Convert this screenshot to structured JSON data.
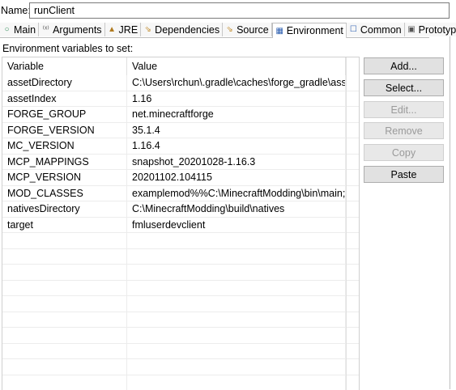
{
  "name_row": {
    "label": "Name:",
    "value": "runClient"
  },
  "tabs": [
    {
      "label": "Main",
      "icon": "○"
    },
    {
      "label": "Arguments",
      "icon": "⁽ˣ⁾"
    },
    {
      "label": "JRE",
      "icon": "▲"
    },
    {
      "label": "Dependencies",
      "icon": "⇘"
    },
    {
      "label": "Source",
      "icon": "⇘"
    },
    {
      "label": "Environment",
      "icon": "▦"
    },
    {
      "label": "Common",
      "icon": "☐"
    },
    {
      "label": "Prototype",
      "icon": "▣"
    }
  ],
  "section_label": "Environment variables to set:",
  "table": {
    "headers": {
      "variable": "Variable",
      "value": "Value"
    },
    "rows": [
      {
        "variable": "assetDirectory",
        "value": "C:\\Users\\rchun\\.gradle\\caches\\forge_gradle\\assets"
      },
      {
        "variable": "assetIndex",
        "value": "1.16"
      },
      {
        "variable": "FORGE_GROUP",
        "value": "net.minecraftforge"
      },
      {
        "variable": "FORGE_VERSION",
        "value": "35.1.4"
      },
      {
        "variable": "MC_VERSION",
        "value": "1.16.4"
      },
      {
        "variable": "MCP_MAPPINGS",
        "value": "snapshot_20201028-1.16.3"
      },
      {
        "variable": "MCP_VERSION",
        "value": "20201102.104115"
      },
      {
        "variable": "MOD_CLASSES",
        "value": "examplemod%%C:\\MinecraftModding\\bin\\main;e..."
      },
      {
        "variable": "nativesDirectory",
        "value": "C:\\MinecraftModding\\build\\natives"
      },
      {
        "variable": "target",
        "value": "fmluserdevclient"
      }
    ]
  },
  "buttons": {
    "add": "Add...",
    "select": "Select...",
    "edit": "Edit...",
    "remove": "Remove",
    "copy": "Copy",
    "paste": "Paste"
  }
}
